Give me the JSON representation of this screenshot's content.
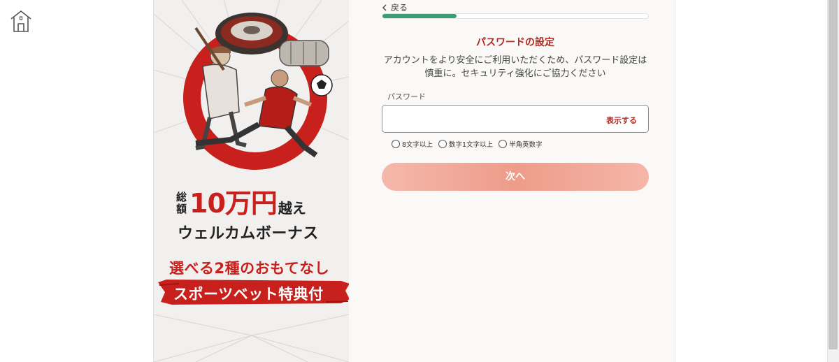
{
  "home": {
    "icon": "home-icon"
  },
  "banner": {
    "bonus_prefix_1": "総",
    "bonus_prefix_2": "額",
    "bonus_amount": "10万円",
    "bonus_suffix": "越え",
    "bonus_line2": "ウェルカムボーナス",
    "choice_line": "選べる2種のおもてなし",
    "ribbon_text": "スポーツベット特典付",
    "accent_color": "#c8201c"
  },
  "form": {
    "back_label": "戻る",
    "progress": 0.28,
    "progress_color": "#3d9c74",
    "title": "パスワードの設定",
    "description_1": "アカウントをより安全にご利用いただくため、パスワード設定は",
    "description_2": "慎重に。セキュリティ強化にご協力ください",
    "password_label": "パスワード",
    "password_value": "",
    "show_label": "表示する",
    "rules": [
      "8文字以上",
      "数字1文字以上",
      "半角英数字"
    ],
    "next_label": "次へ",
    "next_color": "#ee9c8a"
  }
}
